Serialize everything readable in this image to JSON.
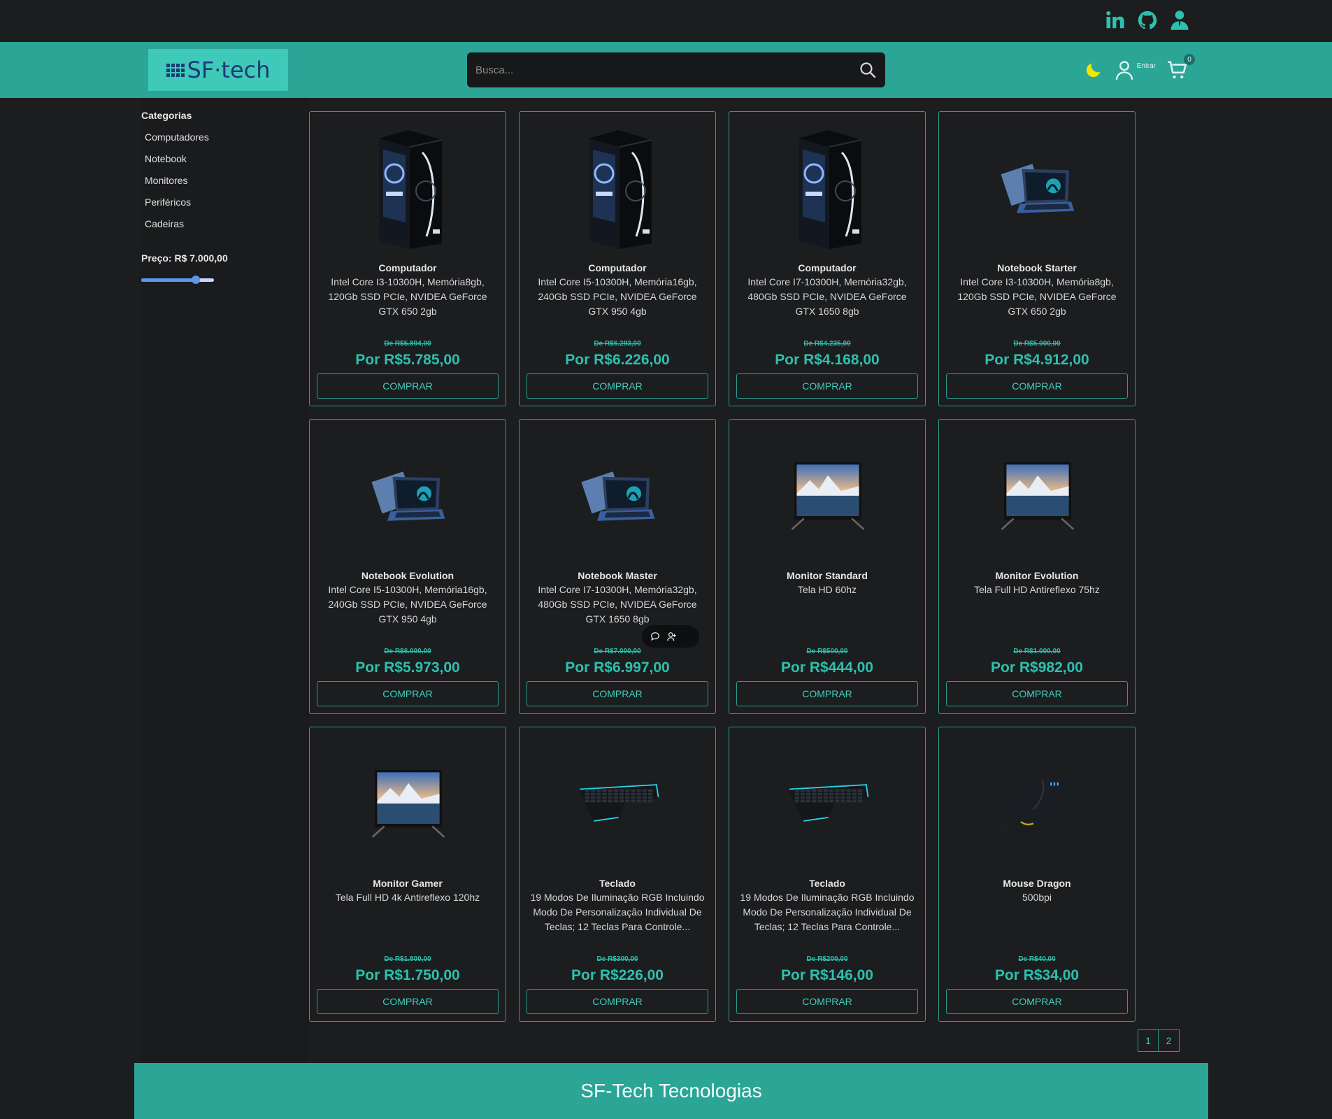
{
  "header": {
    "logo_text": "SF·tech",
    "search_placeholder": "Busca...",
    "login_label": "Entrar",
    "cart_count": "0",
    "theme_icon": "moon-icon"
  },
  "social": [
    "linkedin-icon",
    "github-icon",
    "portfolio-icon"
  ],
  "sidebar": {
    "categories_title": "Categorias",
    "categories": [
      "Computadores",
      "Notebook",
      "Monitores",
      "Periféricos",
      "Cadeiras"
    ],
    "price_label": "Preço: R$ 7.000,00",
    "price_slider_fraction": 0.75
  },
  "products": [
    {
      "name": "Computador",
      "desc": "Intel Core I3-10300H, Memória8gb, 120Gb SSD PCIe, NVIDEA GeForce GTX 650 2gb",
      "old_price": "De R$5.804,00",
      "price": "Por R$5.785,00",
      "buy": "COMPRAR",
      "kind": "pc"
    },
    {
      "name": "Computador",
      "desc": "Intel Core I5-10300H, Memória16gb, 240Gb SSD PCIe, NVIDEA GeForce GTX 950 4gb",
      "old_price": "De R$6.293,00",
      "price": "Por R$6.226,00",
      "buy": "COMPRAR",
      "kind": "pc"
    },
    {
      "name": "Computador",
      "desc": "Intel Core I7-10300H, Memória32gb, 480Gb SSD PCIe, NVIDEA GeForce GTX 1650 8gb",
      "old_price": "De R$4.235,00",
      "price": "Por R$4.168,00",
      "buy": "COMPRAR",
      "kind": "pc"
    },
    {
      "name": "Notebook Starter",
      "desc": "Intel Core I3-10300H, Memória8gb, 120Gb SSD PCIe, NVIDEA GeForce GTX 650 2gb",
      "old_price": "De R$5.000,00",
      "price": "Por R$4.912,00",
      "buy": "COMPRAR",
      "kind": "notebook"
    },
    {
      "name": "Notebook Evolution",
      "desc": "Intel Core I5-10300H, Memória16gb, 240Gb SSD PCIe, NVIDEA GeForce GTX 950 4gb",
      "old_price": "De R$6.000,00",
      "price": "Por R$5.973,00",
      "buy": "COMPRAR",
      "kind": "notebook"
    },
    {
      "name": "Notebook Master",
      "desc": "Intel Core I7-10300H, Memória32gb, 480Gb SSD PCIe, NVIDEA GeForce GTX 1650 8gb",
      "old_price": "De R$7.000,00",
      "price": "Por R$6.997,00",
      "buy": "COMPRAR",
      "kind": "notebook"
    },
    {
      "name": "Monitor Standard",
      "desc": "Tela HD 60hz",
      "old_price": "De R$500,00",
      "price": "Por R$444,00",
      "buy": "COMPRAR",
      "kind": "monitor"
    },
    {
      "name": "Monitor Evolution",
      "desc": "Tela Full HD Antireflexo 75hz",
      "old_price": "De R$1.000,00",
      "price": "Por R$982,00",
      "buy": "COMPRAR",
      "kind": "monitor"
    },
    {
      "name": "Monitor Gamer",
      "desc": "Tela Full HD 4k Antireflexo 120hz",
      "old_price": "De R$1.800,00",
      "price": "Por R$1.750,00",
      "buy": "COMPRAR",
      "kind": "monitor"
    },
    {
      "name": "Teclado",
      "desc": "19 Modos De Iluminação RGB Incluindo Modo De Personalização Individual De Teclas; 12 Teclas Para Controle...",
      "old_price": "De R$300,00",
      "price": "Por R$226,00",
      "buy": "COMPRAR",
      "kind": "keyboard"
    },
    {
      "name": "Teclado",
      "desc": "19 Modos De Iluminação RGB Incluindo Modo De Personalização Individual De Teclas; 12 Teclas Para Controle...",
      "old_price": "De R$200,00",
      "price": "Por R$146,00",
      "buy": "COMPRAR",
      "kind": "keyboard"
    },
    {
      "name": "Mouse Dragon",
      "desc": "500bpi",
      "old_price": "De R$40,00",
      "price": "Por R$34,00",
      "buy": "COMPRAR",
      "kind": "mouse"
    }
  ],
  "pagination": [
    "1",
    "2"
  ],
  "footer": {
    "text": "SF-Tech Tecnologias"
  },
  "colors": {
    "accent": "#2aa596",
    "price": "#2cc1ae",
    "background": "#1c1d1f"
  }
}
